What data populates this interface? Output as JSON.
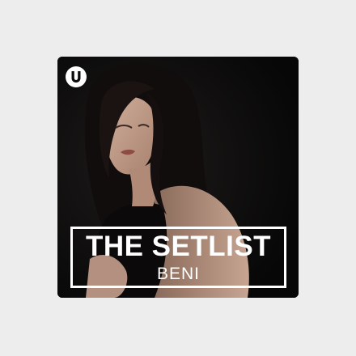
{
  "artwork": {
    "title": "THE SETLIST",
    "artist": "BENI",
    "logo_icon": "u-brand-logo-icon",
    "colors": {
      "page_background": "#ededed",
      "cover_background": "#0d0d0d",
      "text": "#ffffff"
    }
  }
}
